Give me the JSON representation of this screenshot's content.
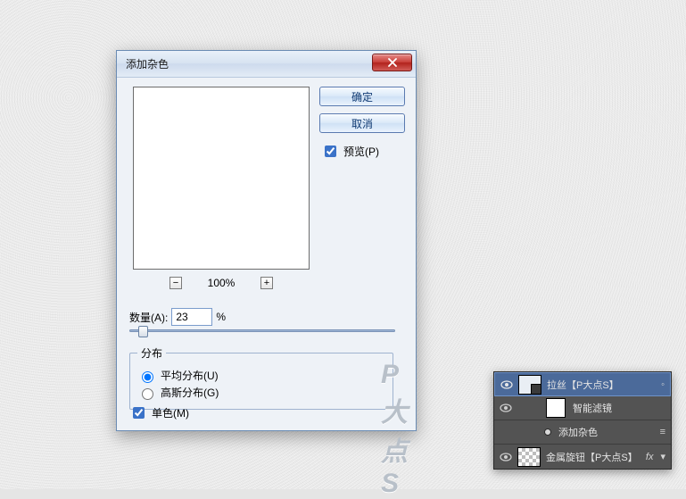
{
  "dialog": {
    "title": "添加杂色",
    "ok_label": "确定",
    "cancel_label": "取消",
    "preview_label": "预览(P)",
    "preview_checked": true,
    "zoom": {
      "minus": "−",
      "plus": "+",
      "percent": "100%"
    },
    "amount": {
      "label": "数量(A):",
      "value": "23",
      "suffix": "%",
      "slider_pos_pct": 3
    },
    "distribution": {
      "legend": "分布",
      "uniform": {
        "label": "平均分布(U)",
        "checked": true
      },
      "gaussian": {
        "label": "高斯分布(G)",
        "checked": false
      }
    },
    "mono": {
      "label": "单色(M)",
      "checked": true
    },
    "watermark": "P大点S"
  },
  "layers": {
    "rows": [
      {
        "name": "拉丝【P大点S】",
        "visible": true,
        "thumb": "smart",
        "selected": true
      },
      {
        "name": "智能滤镜",
        "visible": true,
        "type": "sf-header"
      },
      {
        "name": "添加杂色",
        "type": "sf-filter"
      },
      {
        "name": "金属旋钮【P大点S】",
        "visible": true,
        "thumb": "checker",
        "fx": "fx"
      }
    ],
    "fx_label": "fx",
    "menu_glyph": "≡"
  }
}
